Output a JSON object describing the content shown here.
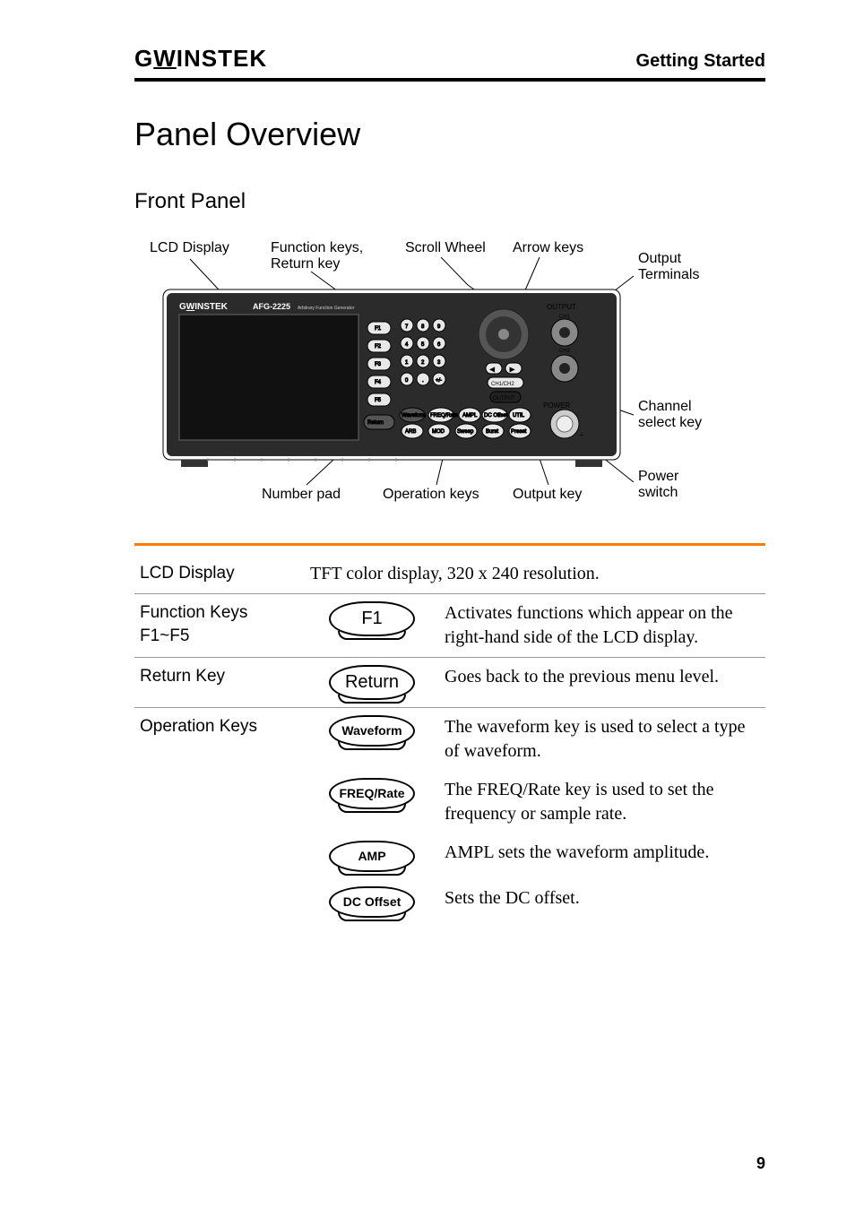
{
  "header": {
    "brand": "GWINSTEK",
    "section": "Getting Started"
  },
  "title": "Panel Overview",
  "subtitle": "Front Panel",
  "diagram_labels": {
    "lcd": "LCD Display",
    "fkeys": "Function keys, Return key",
    "scroll": "Scroll Wheel",
    "arrows": "Arrow keys",
    "out_term": "Output Terminals",
    "ch_sel": "Channel select key",
    "power": "Power switch",
    "outkey": "Output key",
    "opkeys": "Operation keys",
    "numpad": "Number pad",
    "model": "AFG-2225",
    "model_sub": "Arbitrary Function Generator",
    "panel_output": "OUTPUT",
    "panel_power": "POWER",
    "panel_ch1": "CH1",
    "panel_ch2": "CH2",
    "panel_ch1ch2": "CH1/CH2"
  },
  "rows": {
    "lcd": {
      "label": "LCD Display",
      "desc": "TFT color display, 320 x 240 resolution."
    },
    "fkeys": {
      "label": "Function Keys F1~F5",
      "key": "F1",
      "desc": "Activates functions which appear on the right-hand side of the LCD display."
    },
    "return": {
      "label": "Return Key",
      "key": "Return",
      "desc": "Goes back to the previous menu level."
    },
    "op": {
      "label": "Operation Keys",
      "items": [
        {
          "key": "Waveform",
          "desc": "The waveform key is used to select a type of waveform."
        },
        {
          "key": "FREQ/Rate",
          "desc": "The FREQ/Rate key is used to set the frequency or sample rate."
        },
        {
          "key": "AMP",
          "desc": "AMPL sets the waveform amplitude."
        },
        {
          "key": "DC Offset",
          "desc": "Sets the DC offset."
        }
      ]
    }
  },
  "page_number": "9"
}
